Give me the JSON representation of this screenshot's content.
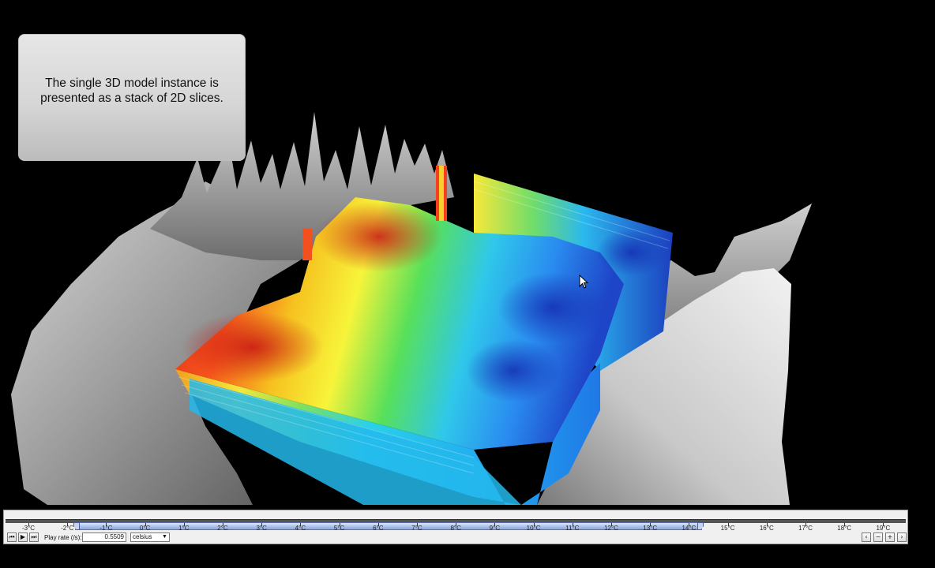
{
  "caption": {
    "text": "The single 3D model instance is presented as a stack of 2D slices."
  },
  "timeline": {
    "ticks": [
      "-3°C",
      "-2°C",
      "-1°C",
      "0°C",
      "1°C",
      "2°C",
      "3°C",
      "4°C",
      "5°C",
      "6°C",
      "7°C",
      "8°C",
      "9°C",
      "10°C",
      "11°C",
      "12°C",
      "13°C",
      "14°C",
      "15°C",
      "16°C",
      "17°C",
      "18°C",
      "19°C"
    ],
    "range_start": "-1.8°C",
    "range_end": "14.2°C",
    "controls": {
      "prev_icon": "skip-back-icon",
      "play_icon": "play-icon",
      "next_icon": "skip-forward-icon",
      "play_rate_label": "Play rate (/s):",
      "play_rate_value": "0.5509",
      "unit_value": "celsius"
    },
    "zoom_buttons": {
      "left_icon": "chevron-left-icon",
      "zoom_out_icon": "minus-icon",
      "zoom_in_icon": "plus-icon",
      "right_icon": "chevron-right-icon"
    }
  },
  "colors": {
    "background": "#000000",
    "terrain": "#bdbdbd",
    "hot": "#e8321e",
    "cold": "#1e50d2"
  }
}
